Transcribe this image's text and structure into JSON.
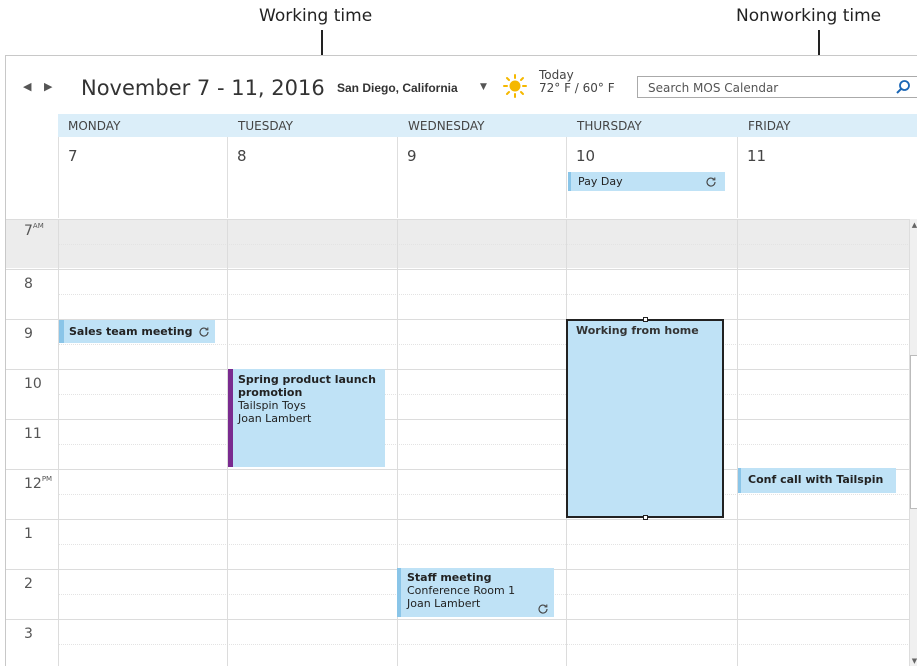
{
  "callouts": {
    "working": "Working time",
    "nonworking": "Nonworking time"
  },
  "header": {
    "prev_icon": "chevron-left-icon",
    "next_icon": "chevron-right-icon",
    "date_range": "November 7 - 11, 2016",
    "location": "San Diego, California",
    "weather_label": "Today",
    "weather_temp": "72° F / 60° F",
    "search_placeholder": "Search MOS Calendar"
  },
  "days": [
    {
      "name": "MONDAY",
      "num": "7"
    },
    {
      "name": "TUESDAY",
      "num": "8"
    },
    {
      "name": "WEDNESDAY",
      "num": "9"
    },
    {
      "name": "THURSDAY",
      "num": "10"
    },
    {
      "name": "FRIDAY",
      "num": "11"
    }
  ],
  "hours": [
    {
      "h": "7",
      "ap": "AM"
    },
    {
      "h": "8",
      "ap": ""
    },
    {
      "h": "9",
      "ap": ""
    },
    {
      "h": "10",
      "ap": ""
    },
    {
      "h": "11",
      "ap": ""
    },
    {
      "h": "12",
      "ap": "PM"
    },
    {
      "h": "1",
      "ap": ""
    },
    {
      "h": "2",
      "ap": ""
    },
    {
      "h": "3",
      "ap": ""
    }
  ],
  "events": {
    "payday": {
      "title": "Pay Day"
    },
    "sales": {
      "title": "Sales team meeting"
    },
    "spring": {
      "title": "Spring product launch promotion",
      "line1": "Tailspin Toys",
      "line2": "Joan Lambert"
    },
    "wfh": {
      "title": "Working from home"
    },
    "conf": {
      "title": "Conf call with Tailspin"
    },
    "staff": {
      "title": "Staff meeting",
      "line1": "Conference Room 1",
      "line2": "Joan Lambert"
    }
  },
  "colors": {
    "accent": "#bfe2f6",
    "purple_bar": "#7a2b8f",
    "header_bg": "#dbeef9",
    "nonworking_bg": "#ececec"
  }
}
